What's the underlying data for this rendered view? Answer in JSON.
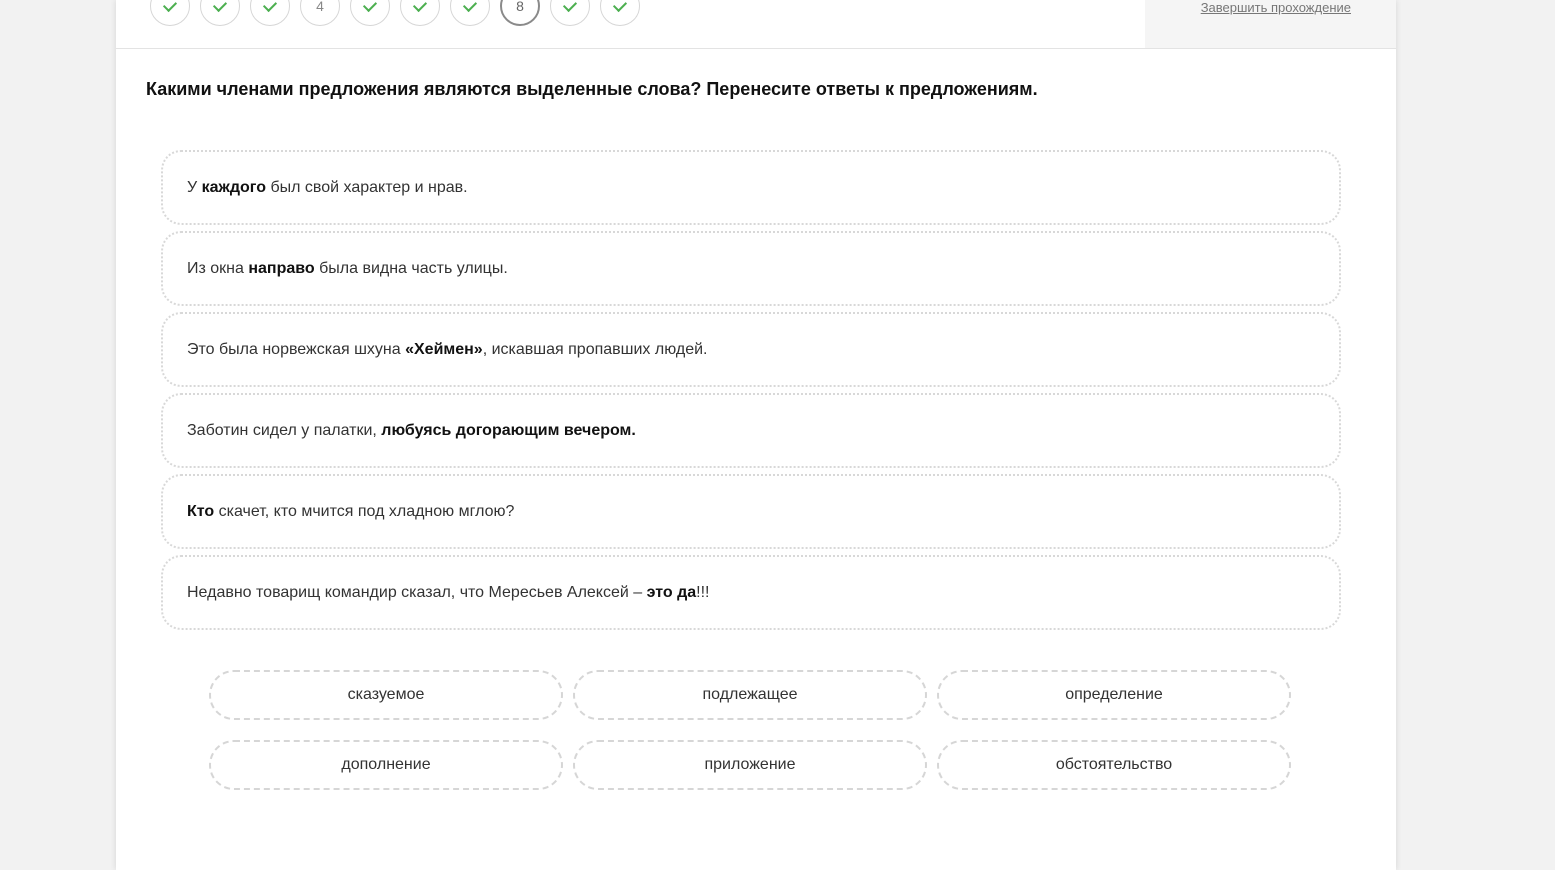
{
  "steps": [
    {
      "state": "done"
    },
    {
      "state": "done"
    },
    {
      "state": "done"
    },
    {
      "state": "number",
      "label": "4"
    },
    {
      "state": "done"
    },
    {
      "state": "done"
    },
    {
      "state": "done"
    },
    {
      "state": "current",
      "label": "8"
    },
    {
      "state": "done"
    },
    {
      "state": "done"
    }
  ],
  "header": {
    "finish_label": "Завершить прохождение"
  },
  "question": "Какими членами предложения являются выделенные слова? Перенесите ответы к предложениям.",
  "sentences": [
    {
      "pre": "У ",
      "bold": "каждого",
      "post": " был свой характер и нрав."
    },
    {
      "pre": "Из окна ",
      "bold": "направо",
      "post": " была видна часть улицы."
    },
    {
      "pre": "Это была норвежская шхуна ",
      "bold": "«Хеймен»",
      "post": ", искавшая пропавших людей."
    },
    {
      "pre": "Заботин сидел у палатки, ",
      "bold": "любуясь догорающим вечером.",
      "post": ""
    },
    {
      "pre": "",
      "bold": "Кто",
      "post": " скачет, кто мчится под хладною мглою?"
    },
    {
      "pre": "Недавно товарищ командир сказал, что Мересьев Алексей – ",
      "bold": "это да",
      "post": "!!!"
    }
  ],
  "answers": [
    "сказуемое",
    "подлежащее",
    "определение",
    "дополнение",
    "приложение",
    "обстоятельство"
  ],
  "colors": {
    "check": "#4caf50",
    "border": "#d6d6d6",
    "background": "#f2f2f2"
  }
}
